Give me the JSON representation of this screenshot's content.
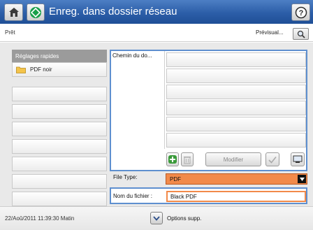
{
  "header": {
    "title": "Enreg. dans dossier réseau",
    "home_icon": "home-icon",
    "app_icon": "network-folder-app-icon",
    "help_icon": "help-icon",
    "accent": "#2c5ea8"
  },
  "status": {
    "text": "Prêt",
    "preview_label": "Prévisual...",
    "preview_icon": "magnifier-icon"
  },
  "quick_settings": {
    "header": "Réglages rapides",
    "items": [
      {
        "label": "PDF noir",
        "icon": "folder-icon"
      }
    ]
  },
  "folder_list": {
    "header": "Chemin du do...",
    "tools": {
      "add_icon": "add-icon",
      "delete_icon": "trash-icon",
      "modify_label": "Modifier",
      "check_icon": "check-icon",
      "browse_icon": "browse-icon"
    }
  },
  "form": {
    "file_type_label": "File Type:",
    "file_type_value": "PDF",
    "file_name_label": "Nom du fichier :",
    "file_name_value": "Black PDF"
  },
  "footer": {
    "datetime": "22/Aoû/2011 11:39:30 Matin",
    "options_label": "Options supp.",
    "options_icon": "chevron-down-icon"
  }
}
